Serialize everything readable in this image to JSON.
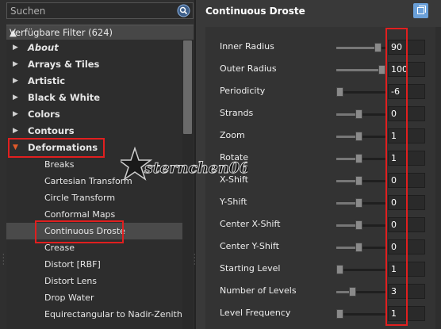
{
  "search": {
    "placeholder": "Suchen"
  },
  "filters_header": "Verfügbare Filter (624)",
  "categories": [
    {
      "label": "About",
      "italic": true
    },
    {
      "label": "Arrays & Tiles"
    },
    {
      "label": "Artistic"
    },
    {
      "label": "Black & White"
    },
    {
      "label": "Colors"
    },
    {
      "label": "Contours"
    },
    {
      "label": "Deformations",
      "expanded": true
    }
  ],
  "deformations": [
    "Breaks",
    "Cartesian Transform",
    "Circle Transform",
    "Conformal Maps",
    "Continuous Droste",
    "Crease",
    "Distort [RBF]",
    "Distort Lens",
    "Drop Water",
    "Equirectangular to Nadir-Zenith"
  ],
  "selected_filter": "Continuous Droste",
  "panel": {
    "title": "Continuous Droste"
  },
  "params": [
    {
      "label": "Inner Radius",
      "value": "90",
      "pos": 0.9
    },
    {
      "label": "Outer Radius",
      "value": "100",
      "pos": 1.0
    },
    {
      "label": "Periodicity",
      "value": "-6",
      "pos": 0.0
    },
    {
      "label": "Strands",
      "value": "0",
      "pos": 0.45
    },
    {
      "label": "Zoom",
      "value": "1",
      "pos": 0.45
    },
    {
      "label": "Rotate",
      "value": "1",
      "pos": 0.45
    },
    {
      "label": "X-Shift",
      "value": "0",
      "pos": 0.45
    },
    {
      "label": "Y-Shift",
      "value": "0",
      "pos": 0.45
    },
    {
      "label": "Center X-Shift",
      "value": "0",
      "pos": 0.45
    },
    {
      "label": "Center Y-Shift",
      "value": "0",
      "pos": 0.45
    },
    {
      "label": "Starting Level",
      "value": "1",
      "pos": 0.0
    },
    {
      "label": "Number of Levels",
      "value": "3",
      "pos": 0.3
    },
    {
      "label": "Level Frequency",
      "value": "1",
      "pos": 0.0
    }
  ],
  "watermark": "sternchen06",
  "colors": {
    "highlight": "#e11f1f",
    "accent": "#6aa0d9"
  }
}
